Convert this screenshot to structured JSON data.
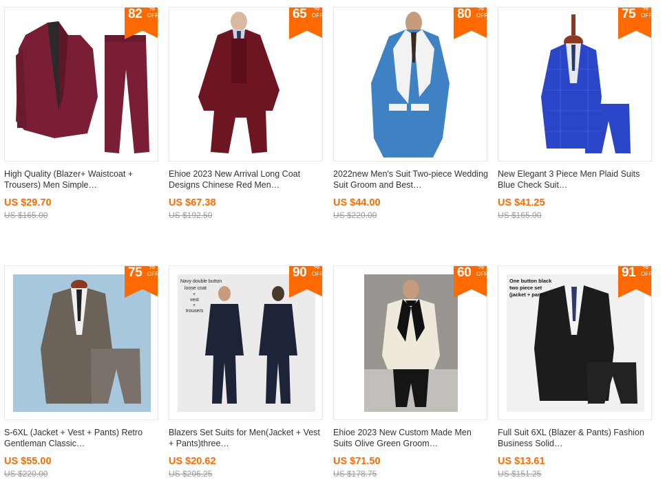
{
  "products": [
    {
      "title": "High Quality (Blazer+ Waistcoat + Trousers) Men Simple…",
      "price": "US $29.70",
      "original_price": "US $165.00",
      "discount": "82",
      "image": "burgundy-suit-with-pants",
      "suit_color": "#7a1e35"
    },
    {
      "title": "Ehioe 2023 New Arrival Long Coat Designs Chinese Red Men…",
      "price": "US $67.38",
      "original_price": "US $192.50",
      "discount": "65",
      "image": "red-long-coat-suit",
      "suit_color": "#6e1522"
    },
    {
      "title": "2022new Men's Suit Two-piece Wedding Suit Groom and Best…",
      "price": "US $44.00",
      "original_price": "US $220.00",
      "discount": "80",
      "image": "blue-white-lapel-suit",
      "suit_color": "#3f82c4"
    },
    {
      "title": "New Elegant 3 Piece Men Plaid Suits Blue Check Suit…",
      "price": "US $41.25",
      "original_price": "US $165.00",
      "discount": "75",
      "image": "blue-plaid-suit-mannequin",
      "suit_color": "#2a45c8"
    },
    {
      "title": "S-6XL (Jacket + Vest + Pants) Retro Gentleman Classic…",
      "price": "US $55.00",
      "original_price": "US $220.00",
      "discount": "75",
      "image": "grey-tweed-suit",
      "suit_color": "#6b625a"
    },
    {
      "title": "Blazers Set Suits for Men(Jacket + Vest + Pants)three…",
      "price": "US $20.62",
      "original_price": "US $206.25",
      "discount": "90",
      "image": "navy-suit-front-back",
      "suit_color": "#1d2438",
      "image_caption": [
        "Navy double button",
        "loose coat",
        "+",
        "vest",
        "+",
        "trousers"
      ]
    },
    {
      "title": "Ehioe 2023 New Custom Made Men Suits Olive Green Groom…",
      "price": "US $71.50",
      "original_price": "US $178.75",
      "discount": "60",
      "image": "white-tuxedo-jacket",
      "suit_color": "#efe9dc"
    },
    {
      "title": "Full Suit 6XL (Blazer & Pants) Fashion Business Solid…",
      "price": "US $13.61",
      "original_price": "US $151.25",
      "discount": "91",
      "image": "black-suit-with-pants",
      "suit_color": "#1c1c1e",
      "image_caption": [
        "One button black",
        "two piece set",
        "(jacket + pants)"
      ]
    }
  ],
  "badge": {
    "percent": "%",
    "off": "OFF"
  }
}
